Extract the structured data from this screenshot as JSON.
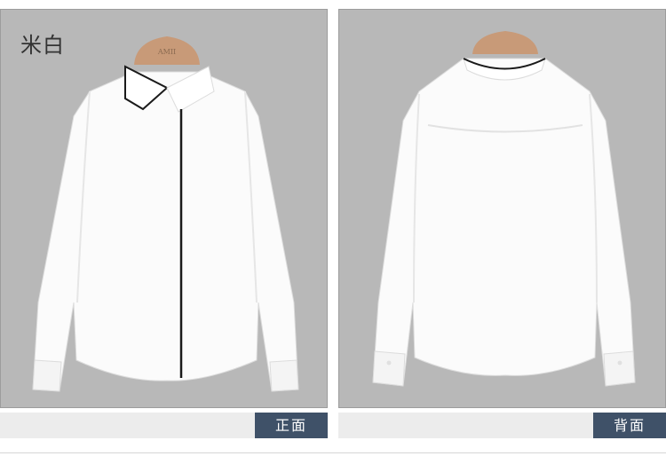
{
  "color_label": "米白",
  "views": {
    "front": {
      "caption": "正面",
      "hanger_text": "AMII"
    },
    "back": {
      "caption": "背面"
    }
  },
  "colors": {
    "panel_background": "#b8b8b8",
    "caption_bar": "#ececec",
    "caption_tag": "#3f5168",
    "shirt": "#fbfbfb",
    "piping": "#1a1a1a"
  }
}
